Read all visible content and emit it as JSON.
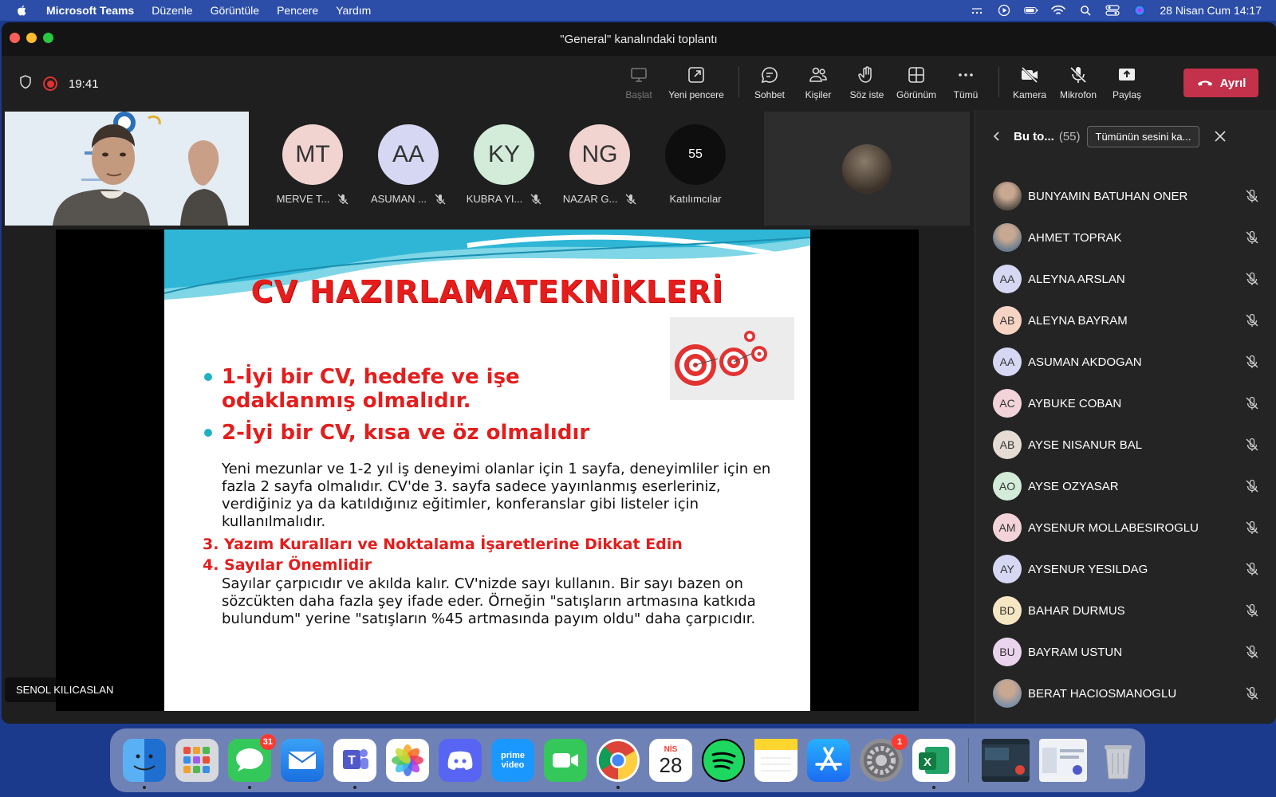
{
  "menubar": {
    "app_name": "Microsoft Teams",
    "items": [
      "Düzenle",
      "Görüntüle",
      "Pencere",
      "Yardım"
    ],
    "datetime": "28 Nisan Cum  14:17"
  },
  "window": {
    "title": "\"General\" kanalındaki toplantı"
  },
  "toolbar": {
    "timer": "19:41",
    "buttons": {
      "start": "Başlat",
      "new_window": "Yeni pencere",
      "chat": "Sohbet",
      "people": "Kişiler",
      "raise_hand": "Söz iste",
      "view": "Görünüm",
      "more": "Tümü",
      "camera": "Kamera",
      "mic": "Mikrofon",
      "share": "Paylaş"
    },
    "leave": "Ayrıl",
    "accent": "#7f85f5",
    "leave_color": "#c4314b"
  },
  "participants_strip": [
    {
      "initials": "MT",
      "name": "MERVE T...",
      "color": "#f1d3d0"
    },
    {
      "initials": "AA",
      "name": "ASUMAN ...",
      "color": "#d6d8f3"
    },
    {
      "initials": "KY",
      "name": "KUBRA YI...",
      "color": "#d3ecd9"
    },
    {
      "initials": "NG",
      "name": "NAZAR G...",
      "color": "#f1d3d0"
    }
  ],
  "participant_count": {
    "value": "55",
    "label": "Katılımcılar"
  },
  "slide": {
    "title": "CV HAZIRLAMATEKNİKLERİ",
    "bullet1": "1-İyi bir CV, hedefe ve işe odaklanmış olmalıdır.",
    "bullet2": "2-İyi bir CV, kısa ve öz olmalıdır",
    "para1": "Yeni mezunlar ve 1-2 yıl iş deneyimi olanlar için 1 sayfa, deneyimliler için en fazla 2 sayfa olmalıdır. CV'de 3. sayfa sadece yayınlanmış eserleriniz, verdiğiniz ya da katıldığınız eğitimler, konferanslar gibi listeler için kullanılmalıdır.",
    "item3": "3. Yazım Kuralları ve Noktalama İşaretlerine Dikkat Edin",
    "item4": "4. Sayılar Önemlidir",
    "para2": "Sayılar çarpıcıdır ve akılda kalır. CV'nizde sayı kullanın. Bir sayı bazen on sözcükten daha fazla şey ifade eder. Örneğin \"satışların artmasına katkıda bulundum\" yerine \"satışların %45 artmasında payım oldu\" daha çarpıcıdır."
  },
  "speaker_label": "SENOL KILICASLAN",
  "roster": {
    "title": "Bu to...",
    "count": "(55)",
    "mute_all": "Tümünün sesini ka...",
    "people": [
      {
        "initials": "",
        "name": "BUNYAMIN BATUHAN ONER",
        "color": "#5a5148",
        "photo": true
      },
      {
        "initials": "",
        "name": "AHMET TOPRAK",
        "color": "#6b7d8e",
        "photo": true
      },
      {
        "initials": "AA",
        "name": "ALEYNA ARSLAN",
        "color": "#d6d8f3"
      },
      {
        "initials": "AB",
        "name": "ALEYNA BAYRAM",
        "color": "#f6d4c4"
      },
      {
        "initials": "AA",
        "name": "ASUMAN AKDOGAN",
        "color": "#d6d8f3"
      },
      {
        "initials": "AC",
        "name": "AYBUKE COBAN",
        "color": "#f3d3da"
      },
      {
        "initials": "AB",
        "name": "AYSE NISANUR BAL",
        "color": "#e5dcd4"
      },
      {
        "initials": "AO",
        "name": "AYSE OZYASAR",
        "color": "#d3ecd9"
      },
      {
        "initials": "AM",
        "name": "AYSENUR MOLLABESIROGLU",
        "color": "#f3d3da"
      },
      {
        "initials": "AY",
        "name": "AYSENUR YESILDAG",
        "color": "#d6d8f3"
      },
      {
        "initials": "BD",
        "name": "BAHAR DURMUS",
        "color": "#f6e7c4"
      },
      {
        "initials": "BU",
        "name": "BAYRAM USTUN",
        "color": "#ead3ec"
      },
      {
        "initials": "",
        "name": "BERAT HACIOSMANOGLU",
        "color": "#7d8fa6",
        "photo": true
      }
    ]
  },
  "dock": {
    "messages_badge": "31",
    "calendar_month": "NİS",
    "calendar_day": "28",
    "settings_badge": "1",
    "prime_label": "prime video"
  }
}
